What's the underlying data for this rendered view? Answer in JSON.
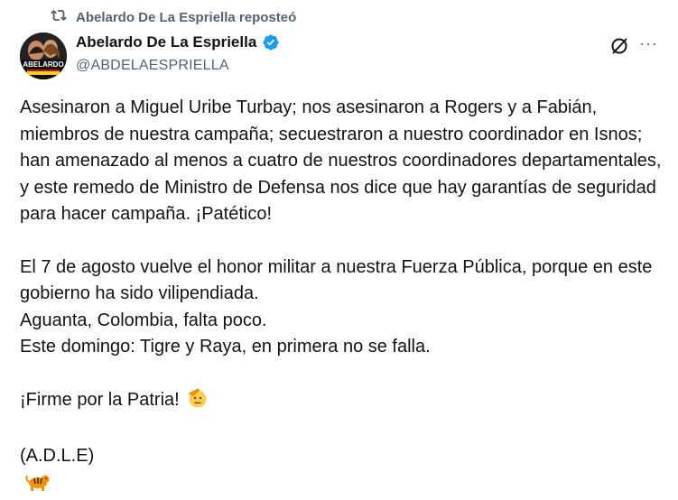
{
  "repost": {
    "icon": "repost-icon",
    "text": "Abelardo De La Espriella reposteó"
  },
  "author": {
    "avatar_text": "ABELARDO",
    "name": "Abelardo De La Espriella",
    "handle": "@ABDELAESPRIELLA",
    "verified": true
  },
  "actions": {
    "grok_icon": "grok-icon",
    "more_label": "···"
  },
  "post": {
    "paragraph1": "Asesinaron a Miguel Uribe Turbay; nos asesinaron a Rogers y a Fabián, miembros de nuestra campaña; secuestraron a nuestro coordinador en Isnos; han amenazado al menos a cuatro de nuestros coordinadores departamentales, y este remedo de Ministro de Defensa nos dice que hay garantías de seguridad para hacer campaña. ¡Patético!",
    "line2a": "El 7 de agosto vuelve el honor militar a nuestra Fuerza Pública, porque en este gobierno ha sido vilipendiada.",
    "line2b": "Aguanta, Colombia, falta poco.",
    "line2c": "Este domingo: Tigre y Raya, en primera no se falla.",
    "line3": "¡Firme por la Patria!",
    "line4": "(A.D.L.E)"
  },
  "colors": {
    "verified_blue": "#1d9bf0",
    "secondary_text": "#536471",
    "flag_yellow": "#fcd116",
    "flag_blue": "#003893",
    "flag_red": "#ce1126"
  }
}
